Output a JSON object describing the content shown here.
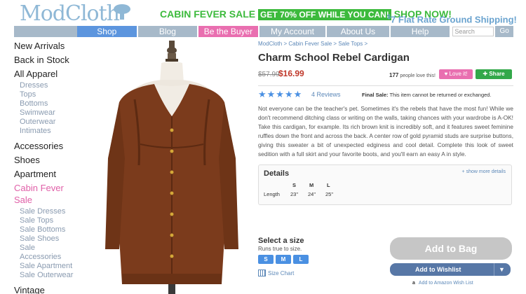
{
  "header": {
    "logo": "ModCloth",
    "promo_text": "CABIN FEVER SALE",
    "promo_highlight": "GET 70% OFF WHILE YOU CAN!",
    "promo_cta": "SHOP NOW!",
    "shipping_amount": "7",
    "shipping_text": "Flat Rate Ground Shipping!"
  },
  "nav": {
    "items": [
      "Shop",
      "Blog",
      "Be the Buyer",
      "My Account",
      "About Us",
      "Help"
    ],
    "search_placeholder": "Search",
    "go": "Go"
  },
  "sidebar": {
    "new_arrivals": "New Arrivals",
    "back_in_stock": "Back in Stock",
    "all_apparel": "All Apparel",
    "apparel_sub": [
      "Dresses",
      "Tops",
      "Bottoms",
      "Swimwear",
      "Outerwear",
      "Intimates"
    ],
    "accessories": "Accessories",
    "shoes": "Shoes",
    "apartment": "Apartment",
    "cabin_fever": "Cabin Fever",
    "sale": "Sale",
    "sale_sub": [
      "Sale Dresses",
      "Sale Tops",
      "Sale Bottoms",
      "Sale Shoes",
      "Sale",
      "Accessories",
      "Sale Apartment",
      "Sale Outerwear"
    ],
    "vintage": "Vintage"
  },
  "product": {
    "breadcrumb": [
      "ModCloth",
      "Cabin Fever Sale",
      "Sale Tops"
    ],
    "title": "Charm School Rebel Cardigan",
    "old_price": "$57.99",
    "new_price": "$16.99",
    "love_count": "177",
    "love_text": "people love this!",
    "love_button": "Love it!",
    "share_button": "Share",
    "rating_stars": "★★★★★",
    "reviews": "4 Reviews",
    "final_sale_bold": "Final Sale:",
    "final_sale_text": "This item cannot be returned or exchanged.",
    "description": "Not everyone can be the teacher's pet. Sometimes it's the rebels that have the most fun! While we don't recommend ditching class or writing on the walls, taking chances with your wardrobe is A-OK! Take this cardigan, for example. Its rich brown knit is incredibly soft, and it features sweet feminine ruffles down the front and across the back. A center row of gold pyramid studs are surprise buttons, giving this sweater a bit of unexpected edginess and cool detail. Complete this look of sweet sedition with a full skirt and your favorite boots, and you'll earn an easy A in style."
  },
  "details": {
    "title": "Details",
    "show_more": "+ show more details",
    "size_headers": [
      "S",
      "M",
      "L"
    ],
    "length_label": "Length",
    "length_values": [
      "23\"",
      "24\"",
      "25\""
    ]
  },
  "purchase": {
    "select_size": "Select a size",
    "runs_true": "Runs true to size.",
    "sizes": [
      "S",
      "M",
      "L"
    ],
    "size_chart": "Size Chart",
    "add_to_bag": "Add to Bag",
    "add_to_wishlist": "Add to Wishlist",
    "amazon_icon": "a",
    "amazon": "Add to Amazon Wish List"
  },
  "colors": {
    "cardigan": "#7b3b1c",
    "accent_blue": "#4a90e2",
    "pink": "#e96fb0",
    "green": "#33a84a"
  }
}
